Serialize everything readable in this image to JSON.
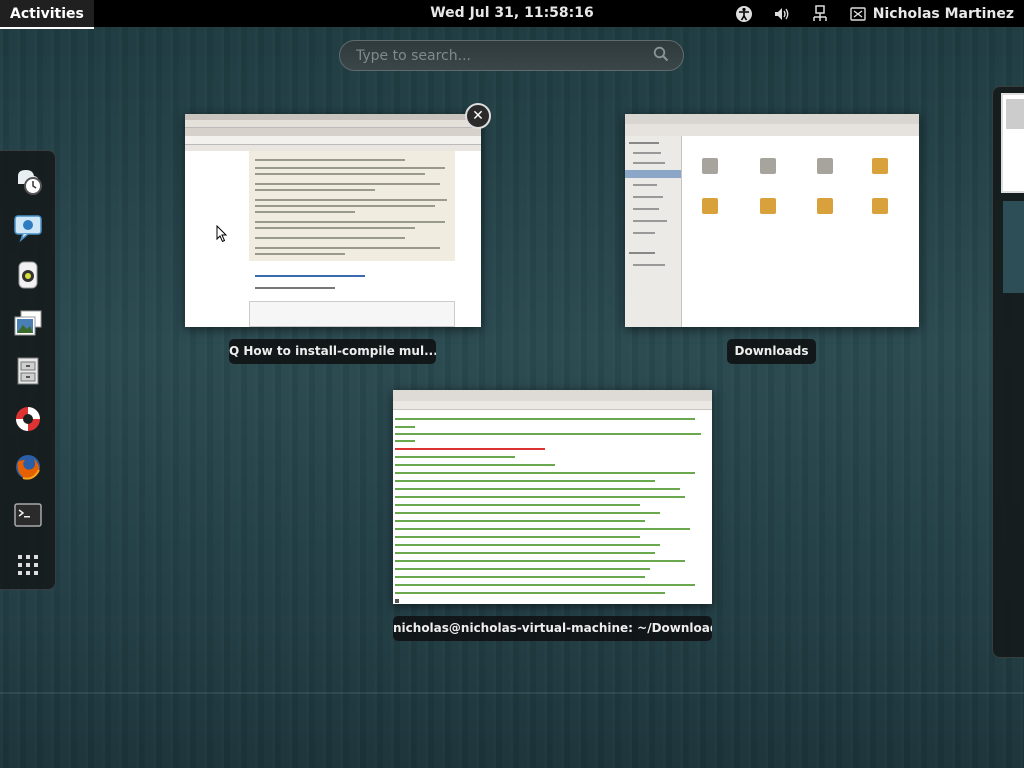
{
  "top_bar": {
    "activities_label": "Activities",
    "clock": "Wed Jul 31, 11:58:16",
    "user_name": "Nicholas Martinez",
    "icons": [
      "accessibility-icon",
      "volume-icon",
      "network-icon",
      "user-status-icon"
    ]
  },
  "search": {
    "placeholder": "Type to search..."
  },
  "dash": {
    "apps": [
      "clock-notes-icon",
      "empathy-chat-icon",
      "rhythmbox-icon",
      "shotwell-photos-icon",
      "file-cabinet-icon",
      "help-lifebuoy-icon",
      "firefox-icon",
      "terminal-icon",
      "show-applications-icon"
    ]
  },
  "windows": [
    {
      "title": "Q How to install-compile mul..."
    },
    {
      "title": "Downloads"
    },
    {
      "title": "nicholas@nicholas-virtual-machine: ~/Download..."
    }
  ],
  "colors": {
    "background": "#24434a",
    "top_bar": "#000000",
    "caption_bg": "#0f1213",
    "terminal_green": "#6aa84f",
    "terminal_red": "#dd3333",
    "package_orange": "#d8a13b"
  }
}
